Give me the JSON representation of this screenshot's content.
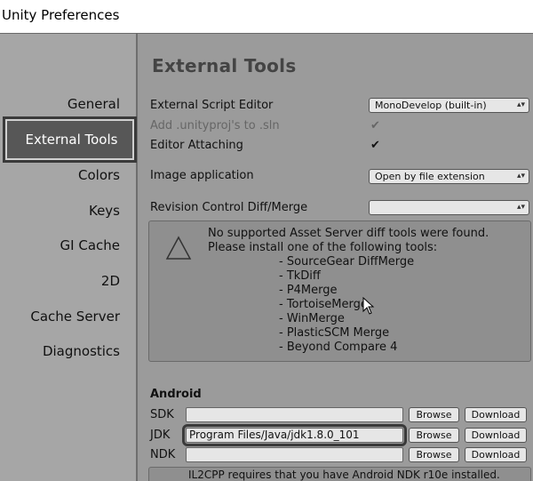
{
  "window": {
    "title": "Unity Preferences"
  },
  "sidebar": {
    "items": [
      {
        "label": "General",
        "selected": false
      },
      {
        "label": "External Tools",
        "selected": true
      },
      {
        "label": "Colors",
        "selected": false
      },
      {
        "label": "Keys",
        "selected": false
      },
      {
        "label": "GI Cache",
        "selected": false
      },
      {
        "label": "2D",
        "selected": false
      },
      {
        "label": "Cache Server",
        "selected": false
      },
      {
        "label": "Diagnostics",
        "selected": false
      }
    ]
  },
  "content": {
    "heading": "External Tools",
    "external_script_editor": {
      "label": "External Script Editor",
      "value": "MonoDevelop (built-in)"
    },
    "add_unityproj": {
      "label": "Add .unityproj's to .sln",
      "checked": true,
      "enabled": false
    },
    "editor_attaching": {
      "label": "Editor Attaching",
      "checked": true
    },
    "image_application": {
      "label": "Image application",
      "value": "Open by file extension"
    },
    "revision_control": {
      "label": "Revision Control Diff/Merge",
      "value": ""
    },
    "notice": {
      "line1": "No supported Asset Server diff tools were found.",
      "line2": "Please install one of the following tools:",
      "tools": [
        "- SourceGear DiffMerge",
        "- TkDiff",
        "- P4Merge",
        "- TortoiseMerge",
        "- WinMerge",
        "- PlasticSCM Merge",
        "- Beyond Compare 4"
      ]
    },
    "android": {
      "title": "Android",
      "rows": [
        {
          "label": "SDK",
          "value": "",
          "browse": "Browse",
          "download": "Download"
        },
        {
          "label": "JDK",
          "value": "Program Files/Java/jdk1.8.0_101",
          "browse": "Browse",
          "download": "Download"
        },
        {
          "label": "NDK",
          "value": "",
          "browse": "Browse",
          "download": "Download"
        }
      ],
      "il2cpp_note": "IL2CPP requires that you have Android NDK r10e installed."
    }
  },
  "colors": {
    "selected_bg": "#575757",
    "panel_bg": "#9b9b9b",
    "sidebar_bg": "#a6a6a6"
  }
}
